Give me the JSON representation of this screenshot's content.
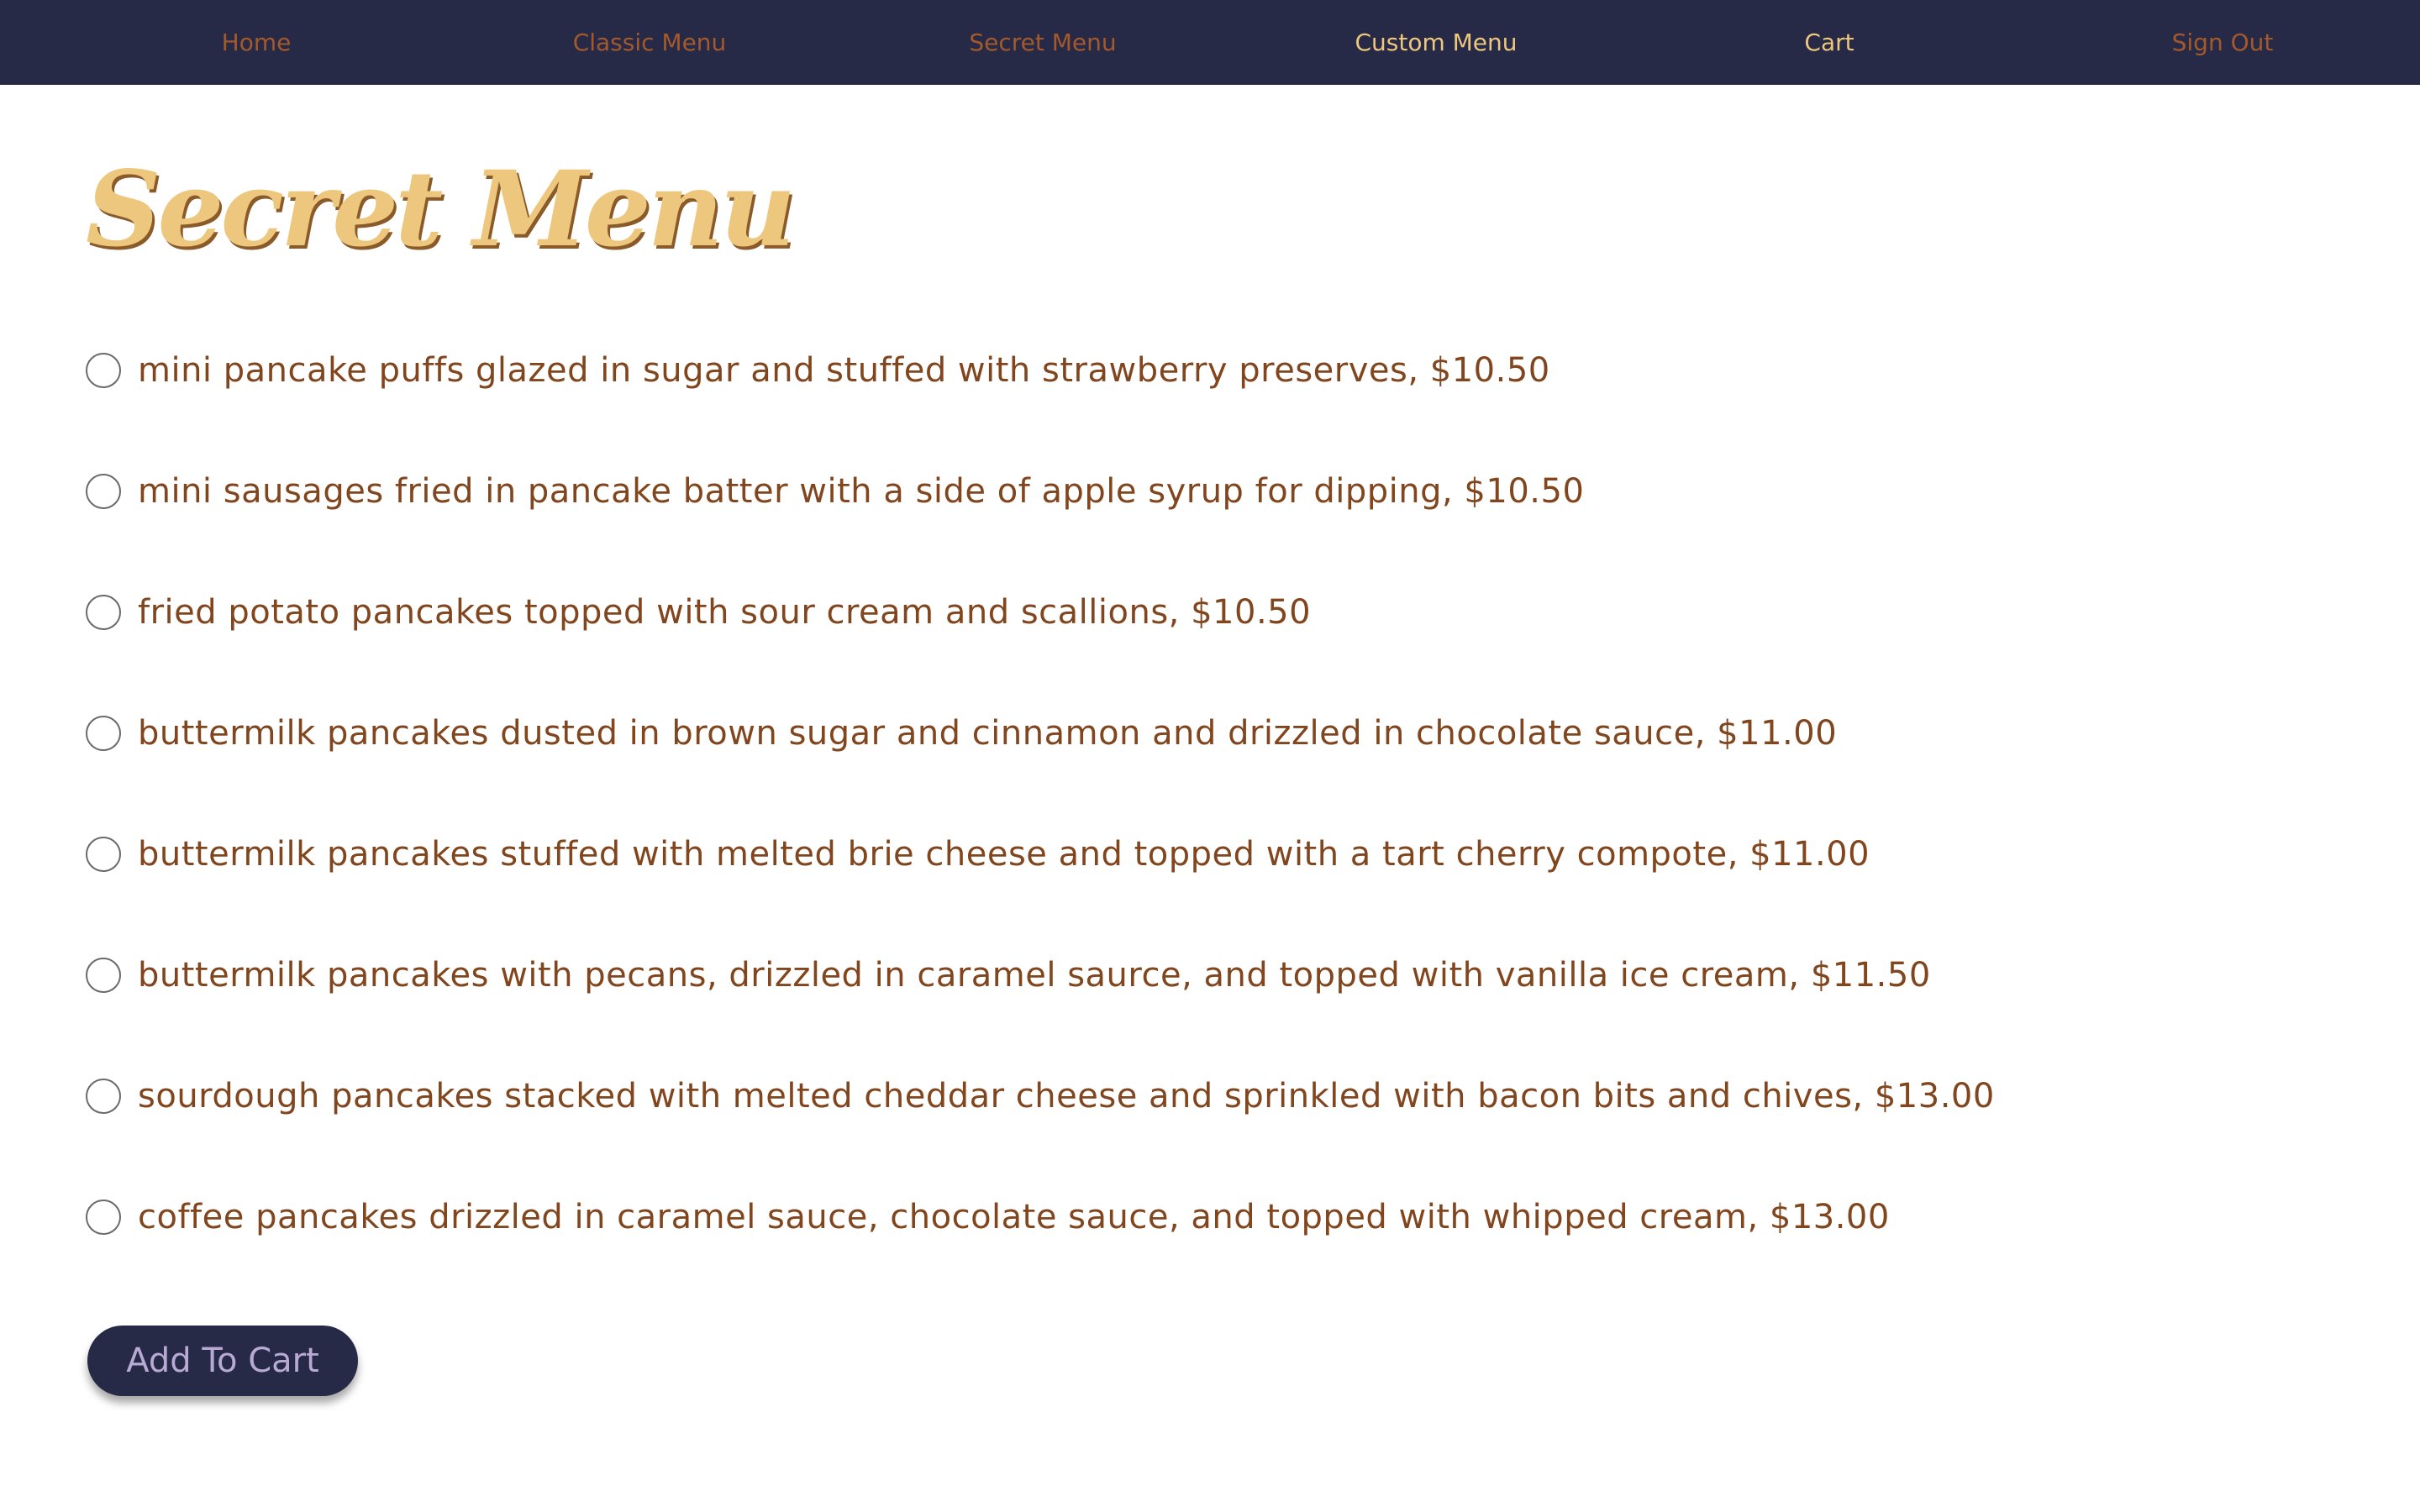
{
  "nav": {
    "home": "Home",
    "classic_menu": "Classic Menu",
    "secret_menu": "Secret Menu",
    "custom_menu": "Custom Menu",
    "cart": "Cart",
    "sign_out": "Sign Out"
  },
  "page": {
    "title": "Secret Menu"
  },
  "menu_items": [
    {
      "label": "mini pancake puffs glazed in sugar and stuffed with strawberry preserves, $10.50"
    },
    {
      "label": "mini sausages fried in pancake batter with a side of apple syrup for dipping, $10.50"
    },
    {
      "label": "fried potato pancakes topped with sour cream and scallions, $10.50"
    },
    {
      "label": "buttermilk pancakes dusted in brown sugar and cinnamon and drizzled in chocolate sauce, $11.00"
    },
    {
      "label": "buttermilk pancakes stuffed with melted brie cheese and topped with a tart cherry compote, $11.00"
    },
    {
      "label": "buttermilk pancakes with pecans, drizzled in caramel saurce, and topped with vanilla ice cream, $11.50"
    },
    {
      "label": "sourdough pancakes stacked with melted cheddar cheese and sprinkled with bacon bits and chives, $13.00"
    },
    {
      "label": "coffee pancakes drizzled in caramel sauce, chocolate sauce, and topped with whipped cream, $13.00"
    }
  ],
  "actions": {
    "add_to_cart": "Add To Cart"
  },
  "colors": {
    "nav_background": "#272a47",
    "nav_link_dim": "#a3592c",
    "nav_link_bright": "#eec77e",
    "title": "#eec77e",
    "item_text": "#82461e",
    "button_background": "#272a47",
    "button_text": "#b8aad4"
  }
}
